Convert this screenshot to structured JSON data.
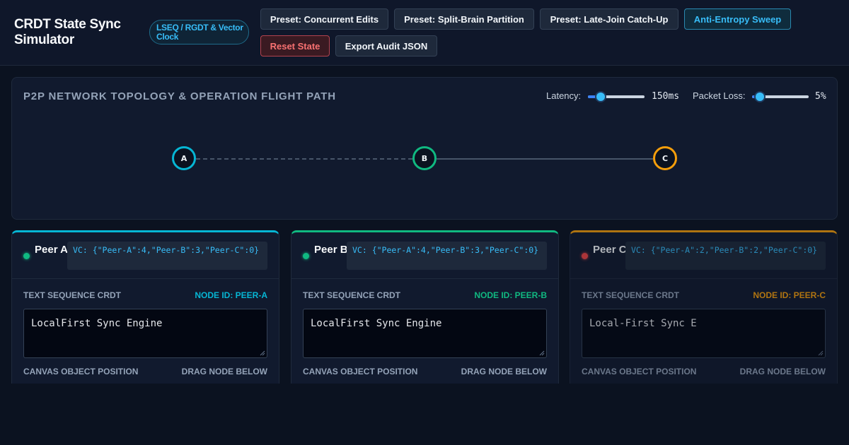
{
  "header": {
    "title": "CRDT State Sync Simulator",
    "badge": "LSEQ / RGDT & Vector Clock",
    "buttons": {
      "concurrent": "Preset: Concurrent Edits",
      "split_brain": "Preset: Split-Brain Partition",
      "late_join": "Preset: Late-Join Catch-Up",
      "anti_entropy": "Anti-Entropy Sweep",
      "reset": "Reset State",
      "export": "Export Audit JSON"
    }
  },
  "topology": {
    "title": "P2P NETWORK TOPOLOGY & OPERATION FLIGHT PATH",
    "latency": {
      "label": "Latency:",
      "display": "150ms",
      "fraction": 0.15
    },
    "packet_loss": {
      "label": "Packet Loss:",
      "display": "5%",
      "fraction": 0.05
    },
    "nodes": [
      {
        "label": "A",
        "color": "#06b6d4"
      },
      {
        "label": "B",
        "color": "#10b981"
      },
      {
        "label": "C",
        "color": "#f59e0b"
      }
    ]
  },
  "peers": [
    {
      "name": "Peer A",
      "status": "online",
      "status_color": "#10b981",
      "accent": "#06b6d4",
      "vector_clock": "VC: {\"Peer-A\":4,\"Peer-B\":3,\"Peer-C\":0}",
      "text_label": "TEXT SEQUENCE CRDT",
      "node_id": "NODE ID: PEER-A",
      "text_value": "LocalFirst Sync Engine",
      "canvas_label": "CANVAS OBJECT POSITION",
      "drag_hint": "DRAG NODE BELOW"
    },
    {
      "name": "Peer B",
      "status": "online",
      "status_color": "#10b981",
      "accent": "#10b981",
      "vector_clock": "VC: {\"Peer-A\":4,\"Peer-B\":3,\"Peer-C\":0}",
      "text_label": "TEXT SEQUENCE CRDT",
      "node_id": "NODE ID: PEER-B",
      "text_value": "LocalFirst Sync Engine",
      "canvas_label": "CANVAS OBJECT POSITION",
      "drag_hint": "DRAG NODE BELOW"
    },
    {
      "name": "Peer C",
      "status": "offline",
      "status_color": "#ef4444",
      "accent": "#f59e0b",
      "vector_clock": "VC: {\"Peer-A\":2,\"Peer-B\":2,\"Peer-C\":0}",
      "text_label": "TEXT SEQUENCE CRDT",
      "node_id": "NODE ID: PEER-C",
      "text_value": "Local-First Sync E",
      "canvas_label": "CANVAS OBJECT POSITION",
      "drag_hint": "DRAG NODE BELOW"
    }
  ]
}
